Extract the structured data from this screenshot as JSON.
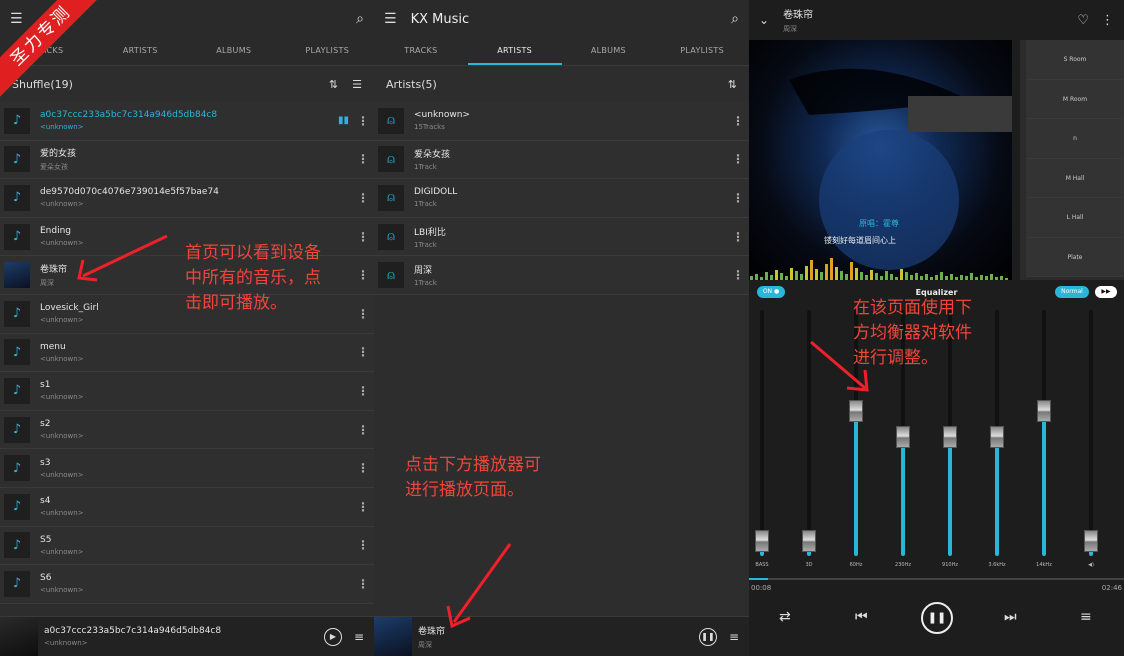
{
  "corner_banner": "圣力专测",
  "panel1": {
    "tabs": [
      "TRACKS",
      "ARTISTS",
      "ALBUMS",
      "PLAYLISTS"
    ],
    "shuffle_label": "Shuffle(19)",
    "tracks": [
      {
        "title": "a0c37ccc233a5bc7c314a946d5db84c8",
        "artist": "<unknown>"
      },
      {
        "title": "爱的女孩",
        "artist": "爱朵女孩"
      },
      {
        "title": "de9570d070c4076e739014e5f57bae74",
        "artist": "<unknown>"
      },
      {
        "title": "Ending",
        "artist": "<unknown>"
      },
      {
        "title": "卷珠帘",
        "artist": "周深"
      },
      {
        "title": "Lovesick_Girl",
        "artist": "<unknown>"
      },
      {
        "title": "menu",
        "artist": "<unknown>"
      },
      {
        "title": "s1",
        "artist": "<unknown>"
      },
      {
        "title": "s2",
        "artist": "<unknown>"
      },
      {
        "title": "s3",
        "artist": "<unknown>"
      },
      {
        "title": "s4",
        "artist": "<unknown>"
      },
      {
        "title": "S5",
        "artist": "<unknown>"
      },
      {
        "title": "S6",
        "artist": "<unknown>"
      }
    ],
    "mini_player": {
      "title": "a0c37ccc233a5bc7c314a946d5db84c8",
      "artist": "<unknown>"
    },
    "annotation": "首页可以看到设备\n中所有的音乐，点\n击即可播放。"
  },
  "panel2": {
    "app_title": "KX Music",
    "tabs": [
      "TRACKS",
      "ARTISTS",
      "ALBUMS",
      "PLAYLISTS"
    ],
    "artists_label": "Artists(5)",
    "artists": [
      {
        "name": "<unknown>",
        "count": "15Tracks"
      },
      {
        "name": "爱朵女孩",
        "count": "1Track"
      },
      {
        "name": "DIGIDOLL",
        "count": "1Track"
      },
      {
        "name": "LBI利比",
        "count": "1Track"
      },
      {
        "name": "周深",
        "count": "1Track"
      }
    ],
    "mini_player": {
      "title": "卷珠帘",
      "artist": "周深"
    },
    "annotation": "点击下方播放器可\n进行播放页面。"
  },
  "panel3": {
    "title": "卷珠帘",
    "artist": "周深",
    "cover_lines": [
      "原唱：霍尊",
      "镂刻好每道眉间心上"
    ],
    "reverb": [
      "S Room",
      "M Room",
      "n",
      "M Hall",
      "L Hall",
      "Plate"
    ],
    "eq_title": "Equalizer",
    "on_label": "ON",
    "preset": "Normal",
    "bands": [
      {
        "label": "BASS",
        "level": 0.02
      },
      {
        "label": "3D",
        "level": 0.02
      },
      {
        "label": "60Hz",
        "level": 0.6
      },
      {
        "label": "230Hz",
        "level": 0.48
      },
      {
        "label": "910Hz",
        "level": 0.48
      },
      {
        "label": "3.6kHz",
        "level": 0.48
      },
      {
        "label": "14kHz",
        "level": 0.6
      },
      {
        "label": "vol",
        "level": 0.02
      }
    ],
    "time_current": "00:08",
    "time_total": "02:46",
    "progress": 0.05,
    "annotation": "在该页面使用下\n方均衡器对软件\n进行调整。"
  }
}
